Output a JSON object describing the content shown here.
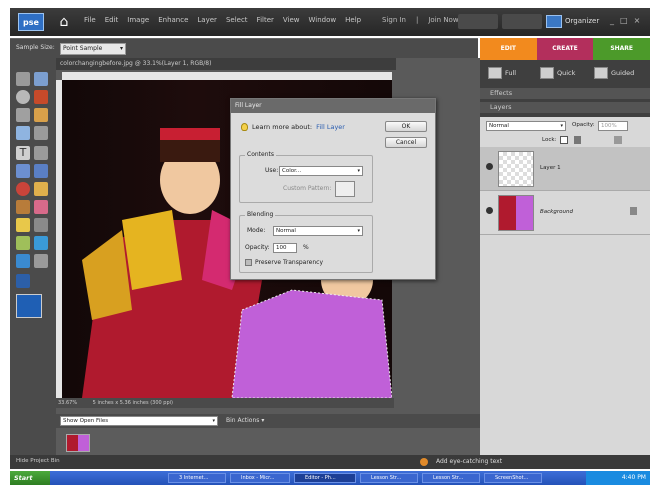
{
  "app": {
    "logo_text": "pse",
    "menu": [
      "File",
      "Edit",
      "Image",
      "Enhance",
      "Layer",
      "Select",
      "Filter",
      "View",
      "Window",
      "Help"
    ],
    "sign_in": "Sign In",
    "join_now": "Join Now",
    "organizer": "Organizer",
    "window_controls": [
      "_",
      "□",
      "×"
    ]
  },
  "options_bar": {
    "sample_size_label": "Sample Size:",
    "sample_size_value": "Point Sample"
  },
  "tabs": [
    {
      "label": "EDIT",
      "color": "#f28a1e"
    },
    {
      "label": "CREATE",
      "color": "#b32f5c"
    },
    {
      "label": "SHARE",
      "color": "#4c9a2a"
    }
  ],
  "edit_modes": [
    {
      "label": "Full",
      "icon": "full-edit-icon"
    },
    {
      "label": "Quick",
      "icon": "quick-edit-icon"
    },
    {
      "label": "Guided",
      "icon": "guided-edit-icon"
    }
  ],
  "panels": {
    "effects": "Effects",
    "layers": "Layers",
    "blend_mode": "Normal",
    "opacity_label": "Opacity:",
    "opacity_value": "100%",
    "lock_label": "Lock:",
    "layer_list": [
      {
        "name": "Layer 1"
      },
      {
        "name": "Background"
      }
    ]
  },
  "document": {
    "title": "colorchangingbefore.jpg @ 33.1%(Layer 1, RGB/8)",
    "zoom": "33.67%",
    "size": "5 inches x 5.36 inches (300 ppi)"
  },
  "dialog": {
    "title": "Fill Layer",
    "learn_text": "Learn more about:",
    "learn_link": "Fill Layer",
    "ok": "OK",
    "cancel": "Cancel",
    "contents_label": "Contents",
    "use_label": "Use:",
    "use_value": "Color...",
    "custom_pattern_label": "Custom Pattern:",
    "blending_label": "Blending",
    "mode_label": "Mode:",
    "mode_value": "Normal",
    "opacity_label": "Opacity:",
    "opacity_value": "100",
    "opacity_unit": "%",
    "preserve_label": "Preserve Transparency"
  },
  "project_bin": {
    "show_label": "Show Open Files",
    "bin_actions": "Bin Actions ▾",
    "hide_label": "Hide Project Bin",
    "hint": "Add eye-catching text"
  },
  "taskbar": {
    "start": "Start",
    "tasks": [
      "3 Internet...",
      "Inbox - Micr...",
      "Editor - Ph...",
      "Lesson Str...",
      "Lesson Str...",
      "ScreenShot..."
    ],
    "clock": "4:40 PM"
  }
}
